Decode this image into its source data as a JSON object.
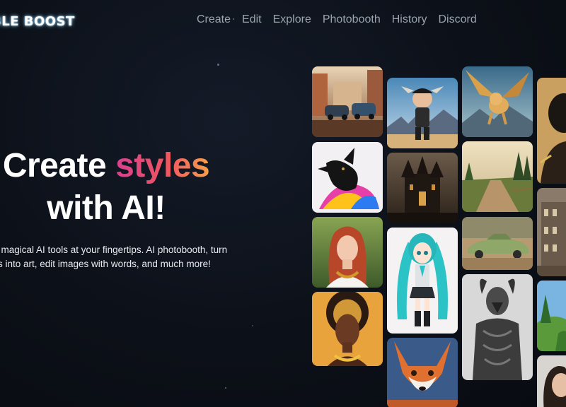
{
  "brand": {
    "logo_text": "BLE BOOST"
  },
  "nav": {
    "items": [
      {
        "label": "Create"
      },
      {
        "label": "Edit"
      },
      {
        "label": "Explore"
      },
      {
        "label": "Photobooth"
      },
      {
        "label": "History"
      },
      {
        "label": "Discord"
      }
    ]
  },
  "hero": {
    "title_line1_prefix": "Create ",
    "title_line1_accent": "styles",
    "title_line2": "with AI!",
    "subtitle_line1": "f magical AI tools at your fingertips. AI photobooth, turn",
    "subtitle_line2": "ls into art, edit images with words, and much more!",
    "accent_gradient": [
      "#d8408f",
      "#f0555f",
      "#f7a04a"
    ]
  },
  "gallery": {
    "images": [
      {
        "subject": "vintage cars on street"
      },
      {
        "subject": "cartoon boy character"
      },
      {
        "subject": "golden flying dog"
      },
      {
        "subject": "portrait silhouette"
      },
      {
        "subject": "black dog with colorful fur"
      },
      {
        "subject": "dark gothic castle"
      },
      {
        "subject": "road through forest"
      },
      {
        "subject": "old buildings"
      },
      {
        "subject": "red-haired woman in forest"
      },
      {
        "subject": "anime girl with teal twintails"
      },
      {
        "subject": "green vintage car"
      },
      {
        "subject": "woman with golden headdress"
      },
      {
        "subject": "armored warrior sketch"
      },
      {
        "subject": "fantasy landscape"
      },
      {
        "subject": "fox portrait"
      },
      {
        "subject": "woman portrait"
      }
    ]
  }
}
